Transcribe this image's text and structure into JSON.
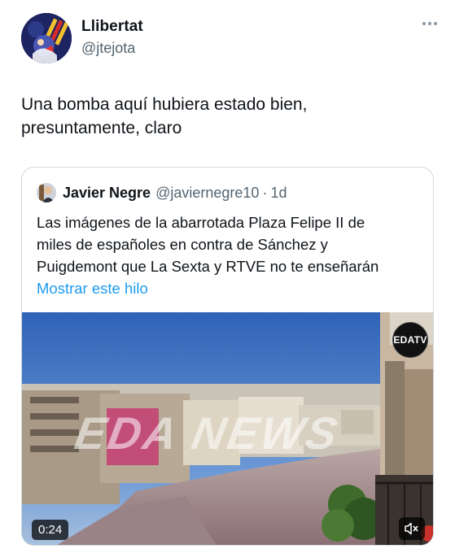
{
  "author": {
    "name": "Llibertat",
    "handle": "@jtejota"
  },
  "tweet": {
    "text_lines": [
      "Una bomba aquí hubiera estado bien,",
      "presuntamente, claro"
    ]
  },
  "quoted": {
    "name": "Javier Negre",
    "handle": "@javiernegre10",
    "separator": "·",
    "time": "1d",
    "text_lines": [
      "Las imágenes de la abarrotada Plaza Felipe II de",
      "miles de españoles en contra de Sánchez y",
      "Puigdemont que La Sexta y RTVE no te enseñarán"
    ],
    "show_thread_label": "Mostrar este hilo",
    "media": {
      "watermark": "EDA NEWS",
      "logo": "EDATV",
      "duration": "0:24"
    }
  },
  "icons": {
    "more": "more-dots-icon",
    "mute": "speaker-muted-icon"
  },
  "colors": {
    "link": "#1d9bf0",
    "secondary_text": "#536471",
    "border": "#cfd9de"
  }
}
